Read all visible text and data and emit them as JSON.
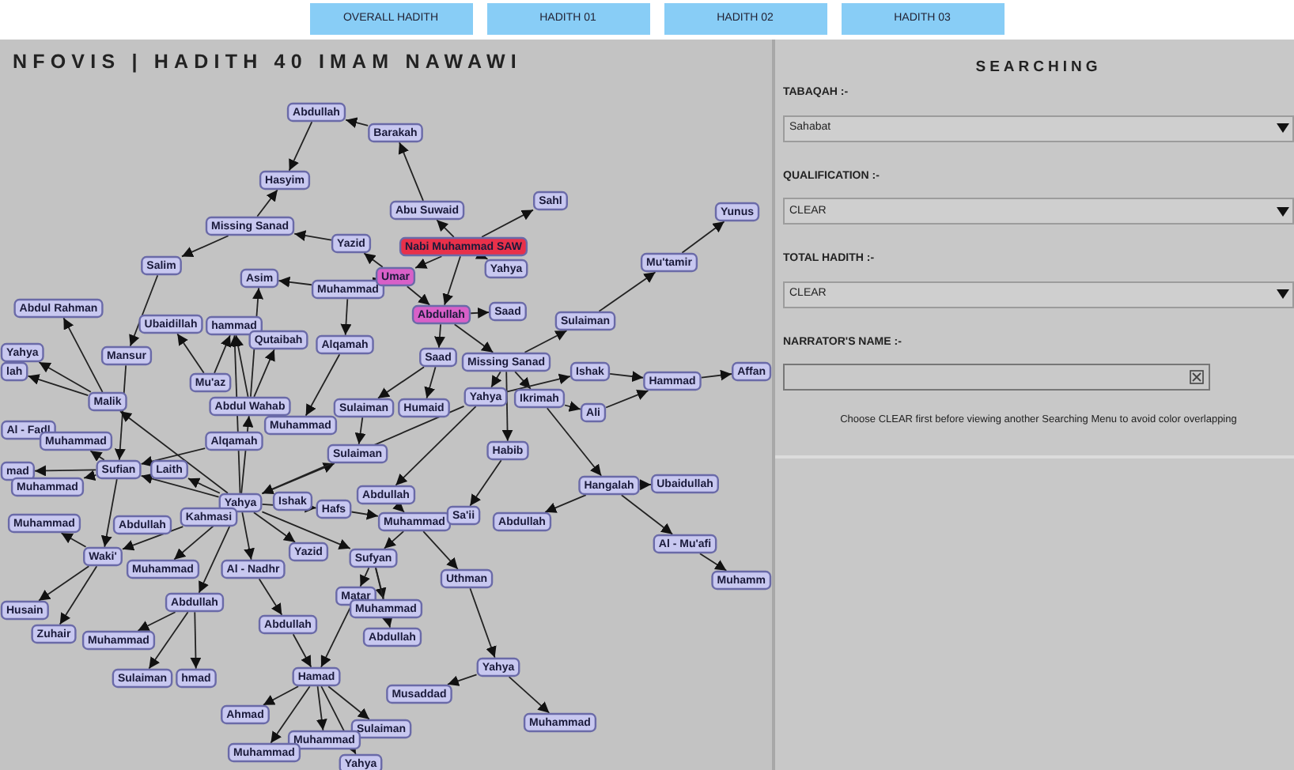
{
  "tabs": [
    {
      "label": "OVERALL HADITH"
    },
    {
      "label": "HADITH 01"
    },
    {
      "label": "HADITH 02"
    },
    {
      "label": "HADITH 03"
    }
  ],
  "graph": {
    "title": "NFOVIS | HADITH 40 IMAM NAWAWI",
    "nodes": [
      {
        "label": "Abdullah",
        "color": "#c8c8f0"
      },
      {
        "label": "Barakah",
        "color": "#c8c8f0"
      },
      {
        "label": "Hasyim",
        "color": "#c8c8f0"
      },
      {
        "label": "Abu Suwaid",
        "color": "#c8c8f0"
      },
      {
        "label": "Sahl",
        "color": "#c8c8f0"
      },
      {
        "label": "Yunus",
        "color": "#c8c8f0"
      },
      {
        "label": "Missing Sanad",
        "color": "#c8c8f0"
      },
      {
        "label": "Yazid",
        "color": "#c8c8f0"
      },
      {
        "label": "Nabi Muhammad SAW",
        "color": "#e8304a"
      },
      {
        "label": "Mu'tamir",
        "color": "#c8c8f0"
      },
      {
        "label": "Salim",
        "color": "#c8c8f0"
      },
      {
        "label": "Asim",
        "color": "#c8c8f0"
      },
      {
        "label": "Muhammad",
        "color": "#c8c8f0"
      },
      {
        "label": "Umar",
        "color": "#d860c8"
      },
      {
        "label": "Yahya",
        "color": "#c8c8f0"
      },
      {
        "label": "Abdullah",
        "color": "#d860c8"
      },
      {
        "label": "Saad",
        "color": "#c8c8f0"
      },
      {
        "label": "Sulaiman",
        "color": "#c8c8f0"
      },
      {
        "label": "Abdul Rahman",
        "color": "#c8c8f0"
      },
      {
        "label": "Ubaidillah",
        "color": "#c8c8f0"
      },
      {
        "label": "hammad",
        "color": "#c8c8f0"
      },
      {
        "label": "Qutaibah",
        "color": "#c8c8f0"
      },
      {
        "label": "Alqamah",
        "color": "#c8c8f0"
      },
      {
        "label": "Saad",
        "color": "#c8c8f0"
      },
      {
        "label": "Missing Sanad",
        "color": "#c8c8f0"
      },
      {
        "label": "Ishak",
        "color": "#c8c8f0"
      },
      {
        "label": "Hammad",
        "color": "#c8c8f0"
      },
      {
        "label": "Affan",
        "color": "#c8c8f0"
      },
      {
        "label": "Yahya",
        "color": "#c8c8f0"
      },
      {
        "label": "lah",
        "color": "#c8c8f0"
      },
      {
        "label": "Mansur",
        "color": "#c8c8f0"
      },
      {
        "label": "Mu'az",
        "color": "#c8c8f0"
      },
      {
        "label": "Abdul Wahab",
        "color": "#c8c8f0"
      },
      {
        "label": "Malik",
        "color": "#c8c8f0"
      },
      {
        "label": "Muhammad",
        "color": "#c8c8f0"
      },
      {
        "label": "Sulaiman",
        "color": "#c8c8f0"
      },
      {
        "label": "Humaid",
        "color": "#c8c8f0"
      },
      {
        "label": "Yahya",
        "color": "#c8c8f0"
      },
      {
        "label": "Ikrimah",
        "color": "#c8c8f0"
      },
      {
        "label": "Ali",
        "color": "#c8c8f0"
      },
      {
        "label": "Alqamah",
        "color": "#c8c8f0"
      },
      {
        "label": "Sulaiman",
        "color": "#c8c8f0"
      },
      {
        "label": "Habib",
        "color": "#c8c8f0"
      },
      {
        "label": "Al - Fadl",
        "color": "#c8c8f0"
      },
      {
        "label": "Muhammad",
        "color": "#c8c8f0"
      },
      {
        "label": "mad",
        "color": "#c8c8f0"
      },
      {
        "label": "Sufian",
        "color": "#c8c8f0"
      },
      {
        "label": "Laith",
        "color": "#c8c8f0"
      },
      {
        "label": "Muhammad",
        "color": "#c8c8f0"
      },
      {
        "label": "Yahya",
        "color": "#c8c8f0"
      },
      {
        "label": "Kahmasi",
        "color": "#c8c8f0"
      },
      {
        "label": "Ishak",
        "color": "#c8c8f0"
      },
      {
        "label": "Abdullah",
        "color": "#c8c8f0"
      },
      {
        "label": "Hafs",
        "color": "#c8c8f0"
      },
      {
        "label": "Muhammad",
        "color": "#c8c8f0"
      },
      {
        "label": "Sa'ii",
        "color": "#c8c8f0"
      },
      {
        "label": "Abdullah",
        "color": "#c8c8f0"
      },
      {
        "label": "Hangalah",
        "color": "#c8c8f0"
      },
      {
        "label": "Ubaidullah",
        "color": "#c8c8f0"
      },
      {
        "label": "Muhammad",
        "color": "#c8c8f0"
      },
      {
        "label": "Abdullah",
        "color": "#c8c8f0"
      },
      {
        "label": "Waki'",
        "color": "#c8c8f0"
      },
      {
        "label": "Muhammad",
        "color": "#c8c8f0"
      },
      {
        "label": "Al - Nadhr",
        "color": "#c8c8f0"
      },
      {
        "label": "Yazid",
        "color": "#c8c8f0"
      },
      {
        "label": "Sufyan",
        "color": "#c8c8f0"
      },
      {
        "label": "Al - Mu'afi",
        "color": "#c8c8f0"
      },
      {
        "label": "Muhamm",
        "color": "#c8c8f0"
      },
      {
        "label": "Husain",
        "color": "#c8c8f0"
      },
      {
        "label": "Abdullah",
        "color": "#c8c8f0"
      },
      {
        "label": "Matar",
        "color": "#c8c8f0"
      },
      {
        "label": "Uthman",
        "color": "#c8c8f0"
      },
      {
        "label": "Muhammad",
        "color": "#c8c8f0"
      },
      {
        "label": "Zuhair",
        "color": "#c8c8f0"
      },
      {
        "label": "Muhammad",
        "color": "#c8c8f0"
      },
      {
        "label": "Abdullah",
        "color": "#c8c8f0"
      },
      {
        "label": "Abdullah",
        "color": "#c8c8f0"
      },
      {
        "label": "Sulaiman",
        "color": "#c8c8f0"
      },
      {
        "label": "hmad",
        "color": "#c8c8f0"
      },
      {
        "label": "Hamad",
        "color": "#c8c8f0"
      },
      {
        "label": "Yahya",
        "color": "#c8c8f0"
      },
      {
        "label": "Ahmad",
        "color": "#c8c8f0"
      },
      {
        "label": "Musaddad",
        "color": "#c8c8f0"
      },
      {
        "label": "Sulaiman",
        "color": "#c8c8f0"
      },
      {
        "label": "Muhammad",
        "color": "#c8c8f0"
      },
      {
        "label": "Muhammad",
        "color": "#c8c8f0"
      },
      {
        "label": "Muhammad",
        "color": "#c8c8f0"
      },
      {
        "label": "Yahya",
        "color": "#c8c8f0"
      }
    ]
  },
  "search_panel": {
    "title": "SEARCHING",
    "filters": [
      {
        "kind": "dropdown",
        "label": "TABAQAH :-",
        "value": "Sahabat"
      },
      {
        "kind": "dropdown",
        "label": "QUALIFICATION :-",
        "value": "CLEAR"
      },
      {
        "kind": "dropdown",
        "label": "TOTAL HADITH :-",
        "value": "CLEAR"
      },
      {
        "kind": "text",
        "label": "NARRATOR'S NAME :-"
      }
    ],
    "note": "Choose CLEAR first before viewing another Searching Menu to avoid color overlapping"
  }
}
